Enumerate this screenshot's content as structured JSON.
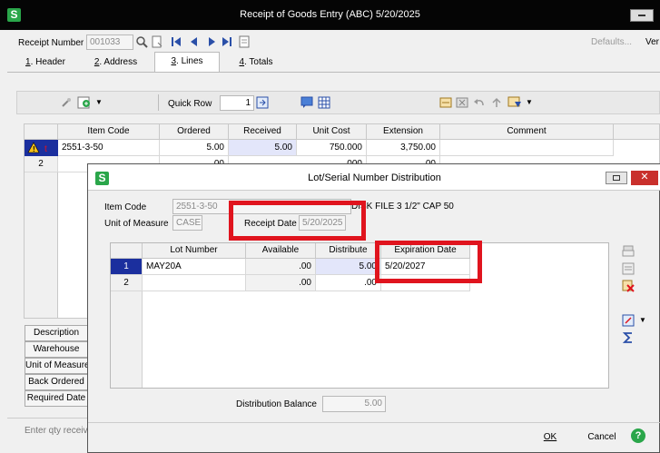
{
  "window": {
    "title": "Receipt of Goods Entry (ABC) 5/20/2025",
    "logo": "S"
  },
  "header": {
    "receipt_number_label": "Receipt Number",
    "receipt_number_value": "001033",
    "defaults_label": "Defaults...",
    "cut_label": "Ver"
  },
  "tabs": [
    {
      "key": "1",
      "label": ". Header"
    },
    {
      "key": "2",
      "label": ". Address"
    },
    {
      "key": "3",
      "label": ". Lines"
    },
    {
      "key": "4",
      "label": ". Totals"
    }
  ],
  "toolbar": {
    "quick_row_label": "Quick Row",
    "quick_row_value": "1"
  },
  "grid": {
    "columns": [
      "Item Code",
      "Ordered",
      "Received",
      "Unit Cost",
      "Extension",
      "Comment"
    ],
    "rows": [
      {
        "num": "",
        "item": "2551-3-50",
        "ordered": "5.00",
        "received": "5.00",
        "unit_cost": "750.000",
        "extension": "3,750.00",
        "comment": ""
      },
      {
        "num": "2",
        "item": "",
        "ordered": ".00",
        "received": "",
        "unit_cost": ".000",
        "extension": ".00",
        "comment": ""
      }
    ]
  },
  "side_labels": [
    "Description",
    "Warehouse",
    "Unit of Measure",
    "Back Ordered",
    "Required Date"
  ],
  "status_text": "Enter qty received",
  "dialog": {
    "title": "Lot/Serial Number Distribution",
    "logo": "S",
    "item_code_label": "Item Code",
    "item_code_value": "2551-3-50",
    "item_desc": "DISK FILE 3 1/2\" CAP 50",
    "uom_label": "Unit of Measure",
    "uom_value": "CASE",
    "receipt_date_label": "Receipt Date",
    "receipt_date_value": "5/20/2025",
    "columns": [
      "Lot Number",
      "Available",
      "Distribute",
      "Expiration Date"
    ],
    "rows": [
      {
        "num": "1",
        "lot": "MAY20A",
        "available": ".00",
        "distribute": "5.00",
        "expiration": "5/20/2027"
      },
      {
        "num": "2",
        "lot": "",
        "available": ".00",
        "distribute": ".00",
        "expiration": ""
      }
    ],
    "balance_label": "Distribution Balance",
    "balance_value": "5.00",
    "ok_label": "OK",
    "cancel_label": "Cancel"
  },
  "colors": {
    "accent_highlight": "#e0141e",
    "selected_row": "#1b2f9e",
    "received_cell": "#e3e6fa"
  }
}
